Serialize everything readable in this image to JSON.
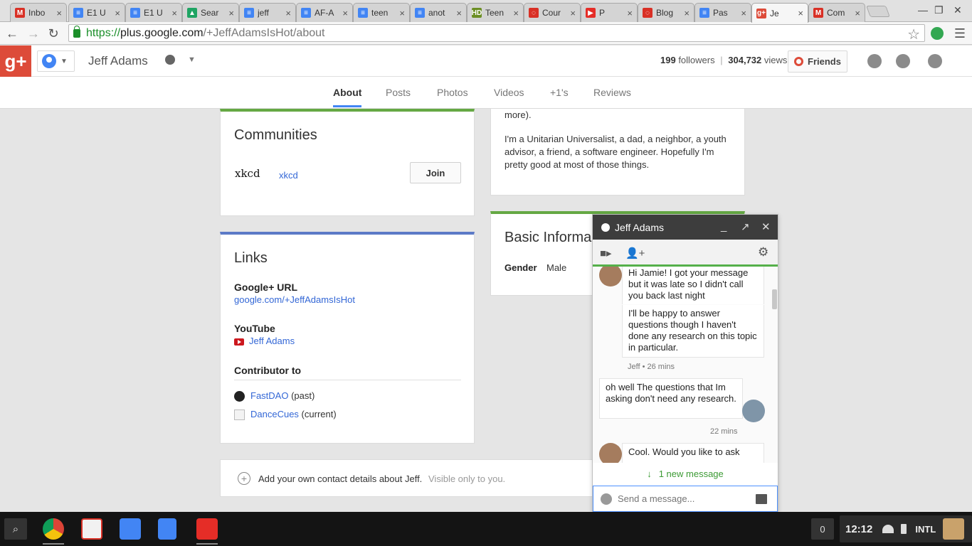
{
  "browser": {
    "tabs": [
      {
        "title": "Inbo",
        "fav": "M",
        "favcolor": "#d93025"
      },
      {
        "title": "E1 U",
        "fav": "≡",
        "favcolor": "#4285f4"
      },
      {
        "title": "E1 U",
        "fav": "≡",
        "favcolor": "#4285f4"
      },
      {
        "title": "Sear",
        "fav": "▲",
        "favcolor": "#1fa463"
      },
      {
        "title": "jeff",
        "fav": "≡",
        "favcolor": "#4285f4"
      },
      {
        "title": "AF-A",
        "fav": "≡",
        "favcolor": "#4285f4"
      },
      {
        "title": "teen",
        "fav": "≡",
        "favcolor": "#4285f4"
      },
      {
        "title": "anot",
        "fav": "≡",
        "favcolor": "#4285f4"
      },
      {
        "title": "Teen",
        "fav": "HD",
        "favcolor": "#6b8e23"
      },
      {
        "title": "Cour",
        "fav": "◌",
        "favcolor": "#d93025"
      },
      {
        "title": "P",
        "fav": "▶",
        "favcolor": "#e52d27"
      },
      {
        "title": "Blog",
        "fav": "◌",
        "favcolor": "#d93025"
      },
      {
        "title": "Pas",
        "fav": "≡",
        "favcolor": "#4285f4"
      },
      {
        "title": "Je",
        "fav": "g+",
        "favcolor": "#dd4b39"
      },
      {
        "title": "Com",
        "fav": "M",
        "favcolor": "#d93025"
      }
    ],
    "url_scheme": "https://",
    "url_host": "plus.google.com",
    "url_path": "/+JeffAdamsIsHot/about"
  },
  "gplus": {
    "logo": "g+",
    "profile_name": "Jeff Adams",
    "followers_count": "199",
    "followers_label": " followers",
    "separator": "|",
    "views_count": "304,732",
    "views_label": " views",
    "friends_button": "Friends",
    "tabs": [
      "About",
      "Posts",
      "Photos",
      "Videos",
      "+1's",
      "Reviews"
    ]
  },
  "about": {
    "intro_tail": "more).",
    "intro_para": "I'm a Unitarian Universalist, a dad, a neighbor, a youth advisor, a friend, a software engineer. Hopefully I'm pretty good at most of those things."
  },
  "communities": {
    "title": "Communities",
    "item_logo": "xkcd",
    "item_name": "xkcd",
    "join_label": "Join"
  },
  "links": {
    "title": "Links",
    "gplus_url_label": "Google+ URL",
    "gplus_url": "google.com/+JeffAdamsIsHot",
    "youtube_label": "YouTube",
    "youtube_name": "Jeff Adams",
    "contributor_label": "Contributor to",
    "contrib1_name": "FastDAO",
    "contrib1_note": " (past)",
    "contrib2_name": "DanceCues",
    "contrib2_note": " (current)"
  },
  "basic": {
    "title": "Basic Informa",
    "gender_label": "Gender",
    "gender_value": "Male"
  },
  "contact": {
    "add_text": "Add your own contact details about Jeff.",
    "visibility": "Visible only to you."
  },
  "chat": {
    "title": "Jeff Adams",
    "msg1a": "Hi Jamie! I got your message but it was late so I didn't call you back last night",
    "msg1b": "I'll be happy to answer questions though I haven't done any research on this topic in particular.",
    "meta1": "Jeff • 26 mins",
    "msg2": "oh well The questions that Im asking don't need any research.",
    "meta2": "22 mins",
    "msg3": "Cool. Would you like to ask",
    "new_message": "1 new message",
    "input_placeholder": "Send a message..."
  },
  "shelf": {
    "notification_count": "0",
    "clock": "12:12",
    "ime": "INTL"
  }
}
